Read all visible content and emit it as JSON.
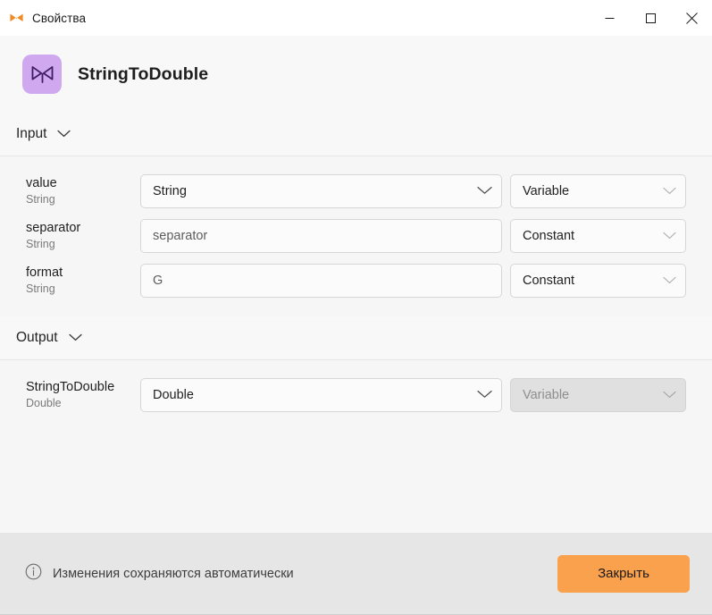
{
  "window": {
    "title": "Свойства",
    "app_icon": "butterfly-icon",
    "controls": {
      "minimize": "minimize-button",
      "maximize": "maximize-button",
      "close": "close-button"
    }
  },
  "header": {
    "icon": "butterfly-icon",
    "icon_bg": "#cfa8f0",
    "name": "StringToDouble"
  },
  "sections": [
    {
      "key": "input",
      "title": "Input",
      "chevron": "chevron-down-icon",
      "rows": [
        {
          "name": "value",
          "type": "String",
          "control": {
            "kind": "dropdown",
            "value": "String",
            "placeholder": false
          },
          "binding": {
            "kind": "dropdown",
            "value": "Variable",
            "disabled": false
          }
        },
        {
          "name": "separator",
          "type": "String",
          "control": {
            "kind": "text",
            "value": "separator",
            "placeholder": true
          },
          "binding": {
            "kind": "dropdown",
            "value": "Constant",
            "disabled": false
          }
        },
        {
          "name": "format",
          "type": "String",
          "control": {
            "kind": "text",
            "value": "G",
            "placeholder": true
          },
          "binding": {
            "kind": "dropdown",
            "value": "Constant",
            "disabled": false
          }
        }
      ]
    },
    {
      "key": "output",
      "title": "Output",
      "chevron": "chevron-down-icon",
      "rows": [
        {
          "name": "StringToDouble",
          "type": "Double",
          "control": {
            "kind": "dropdown",
            "value": "Double",
            "placeholder": false
          },
          "binding": {
            "kind": "dropdown",
            "value": "Variable",
            "disabled": true
          }
        }
      ]
    }
  ],
  "footer": {
    "info_icon": "info-circle-icon",
    "message": "Изменения сохраняются автоматически",
    "close_label": "Закрыть",
    "accent": "#f9a14d"
  }
}
